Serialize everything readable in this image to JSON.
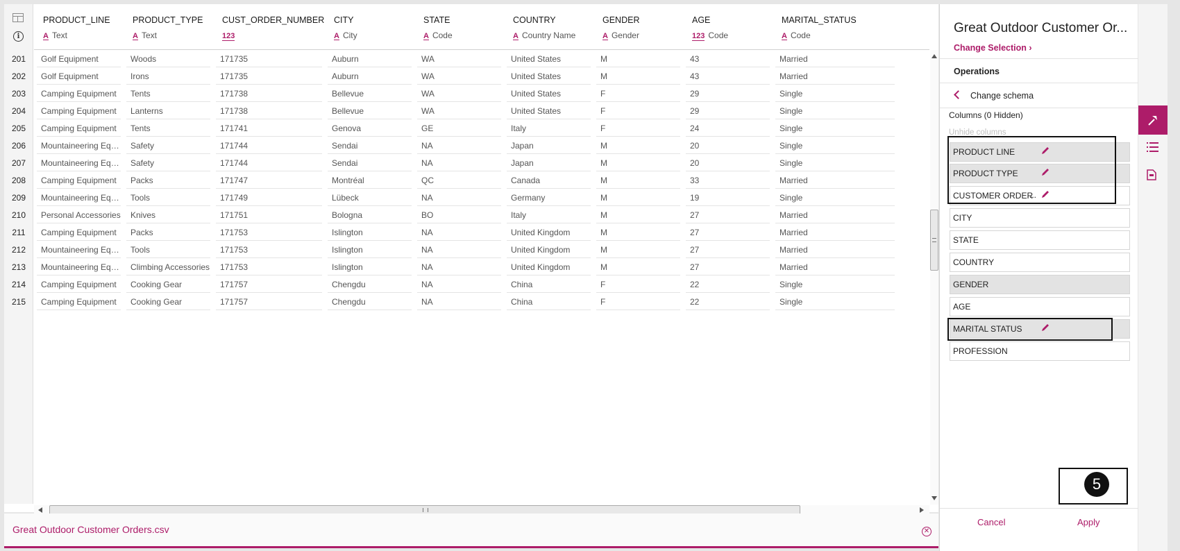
{
  "table": {
    "columns": [
      {
        "name": "PRODUCT_LINE",
        "type_icon": "A",
        "type": "Text"
      },
      {
        "name": "PRODUCT_TYPE",
        "type_icon": "A",
        "type": "Text"
      },
      {
        "name": "CUST_ORDER_NUMBER",
        "type_icon": "123",
        "type": ""
      },
      {
        "name": "CITY",
        "type_icon": "A",
        "type": "City"
      },
      {
        "name": "STATE",
        "type_icon": "A",
        "type": "Code"
      },
      {
        "name": "COUNTRY",
        "type_icon": "A",
        "type": "Country Name"
      },
      {
        "name": "GENDER",
        "type_icon": "A",
        "type": "Gender"
      },
      {
        "name": "AGE",
        "type_icon": "123",
        "type": "Code"
      },
      {
        "name": "MARITAL_STATUS",
        "type_icon": "A",
        "type": "Code"
      }
    ],
    "rows": [
      {
        "num": "201",
        "cells": [
          "Golf Equipment",
          "Woods",
          "171735",
          "Auburn",
          "WA",
          "United States",
          "M",
          "43",
          "Married"
        ]
      },
      {
        "num": "202",
        "cells": [
          "Golf Equipment",
          "Irons",
          "171735",
          "Auburn",
          "WA",
          "United States",
          "M",
          "43",
          "Married"
        ]
      },
      {
        "num": "203",
        "cells": [
          "Camping Equipment",
          "Tents",
          "171738",
          "Bellevue",
          "WA",
          "United States",
          "F",
          "29",
          "Single"
        ]
      },
      {
        "num": "204",
        "cells": [
          "Camping Equipment",
          "Lanterns",
          "171738",
          "Bellevue",
          "WA",
          "United States",
          "F",
          "29",
          "Single"
        ]
      },
      {
        "num": "205",
        "cells": [
          "Camping Equipment",
          "Tents",
          "171741",
          "Genova",
          "GE",
          "Italy",
          "F",
          "24",
          "Single"
        ]
      },
      {
        "num": "206",
        "cells": [
          "Mountaineering Equ...",
          "Safety",
          "171744",
          "Sendai",
          "NA",
          "Japan",
          "M",
          "20",
          "Single"
        ]
      },
      {
        "num": "207",
        "cells": [
          "Mountaineering Equ...",
          "Safety",
          "171744",
          "Sendai",
          "NA",
          "Japan",
          "M",
          "20",
          "Single"
        ]
      },
      {
        "num": "208",
        "cells": [
          "Camping Equipment",
          "Packs",
          "171747",
          "Montréal",
          "QC",
          "Canada",
          "M",
          "33",
          "Married"
        ]
      },
      {
        "num": "209",
        "cells": [
          "Mountaineering Equ...",
          "Tools",
          "171749",
          "Lübeck",
          "NA",
          "Germany",
          "M",
          "19",
          "Single"
        ]
      },
      {
        "num": "210",
        "cells": [
          "Personal Accessories",
          "Knives",
          "171751",
          "Bologna",
          "BO",
          "Italy",
          "M",
          "27",
          "Married"
        ]
      },
      {
        "num": "211",
        "cells": [
          "Camping Equipment",
          "Packs",
          "171753",
          "Islington",
          "NA",
          "United Kingdom",
          "M",
          "27",
          "Married"
        ]
      },
      {
        "num": "212",
        "cells": [
          "Mountaineering Equ...",
          "Tools",
          "171753",
          "Islington",
          "NA",
          "United Kingdom",
          "M",
          "27",
          "Married"
        ]
      },
      {
        "num": "213",
        "cells": [
          "Mountaineering Equ...",
          "Climbing Accessories",
          "171753",
          "Islington",
          "NA",
          "United Kingdom",
          "M",
          "27",
          "Married"
        ]
      },
      {
        "num": "214",
        "cells": [
          "Camping Equipment",
          "Cooking Gear",
          "171757",
          "Chengdu",
          "NA",
          "China",
          "F",
          "22",
          "Single"
        ]
      },
      {
        "num": "215",
        "cells": [
          "Camping Equipment",
          "Cooking Gear",
          "171757",
          "Chengdu",
          "NA",
          "China",
          "F",
          "22",
          "Single"
        ]
      }
    ]
  },
  "file": {
    "name": "Great Outdoor Customer Orders.csv"
  },
  "panel": {
    "title": "Great Outdoor Customer Or...",
    "change_selection": "Change Selection",
    "operations": "Operations",
    "change_schema": "Change schema",
    "columns_label": "Columns (0 Hidden)",
    "unhide": "Unhide columns",
    "column_items": [
      {
        "label": "PRODUCT LINE",
        "selected": true,
        "editable": true
      },
      {
        "label": "PRODUCT TYPE",
        "selected": true,
        "editable": true
      },
      {
        "label": "CUSTOMER ORDER",
        "selected": false,
        "editable": true,
        "truncated": "..."
      },
      {
        "label": "CITY",
        "selected": false,
        "editable": false
      },
      {
        "label": "STATE",
        "selected": false,
        "editable": false
      },
      {
        "label": "COUNTRY",
        "selected": false,
        "editable": false
      },
      {
        "label": "GENDER",
        "selected": true,
        "editable": false
      },
      {
        "label": "AGE",
        "selected": false,
        "editable": false
      },
      {
        "label": "MARITAL STATUS",
        "selected": true,
        "editable": true
      },
      {
        "label": "PROFESSION",
        "selected": false,
        "editable": false
      }
    ],
    "cancel": "Cancel",
    "apply": "Apply"
  },
  "rail": {
    "icons": [
      "hammer-icon",
      "list-icon",
      "document-icon"
    ]
  },
  "annotation": {
    "step": "5"
  },
  "colors": {
    "accent": "#ad1c69",
    "selected_item_bg": "#e3e3e3"
  }
}
